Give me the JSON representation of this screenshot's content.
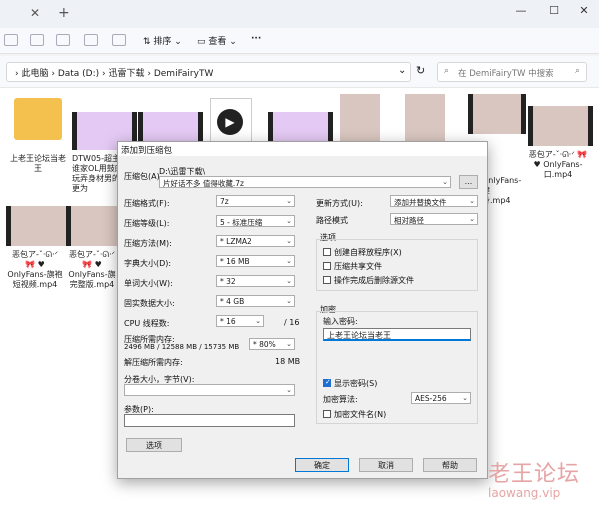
{
  "titlebar": {
    "close_tab": "✕",
    "new_tab": "+",
    "minimize": "—",
    "maximize": "☐",
    "close": "✕"
  },
  "toolbar": {
    "sort_label": "排序",
    "view_label": "查看",
    "more_label": "···"
  },
  "address": {
    "crumbs": [
      "此电脑",
      "Data (D:)",
      "迅雷下载",
      "DemiFairyTW"
    ],
    "search_placeholder": "在 DemiFairyTW 中搜索",
    "refresh_icon": "↻",
    "dropdown_icon": "⌄"
  },
  "files": [
    {
      "name": "上老王论坛当老王",
      "kind": "folder"
    },
    {
      "name": "DTW05-超主的谁家OL用鼓肉睡玩弄身材男的我更为",
      "kind": "video-purple"
    },
    {
      "name": "",
      "kind": "video-purple"
    },
    {
      "name": "",
      "kind": "media"
    },
    {
      "name": "",
      "kind": "video-purple"
    },
    {
      "name": "",
      "kind": "photo"
    },
    {
      "name": "",
      "kind": "photo"
    },
    {
      "name": "OnlyFans-健身.mp4",
      "kind": "video-photo"
    },
    {
      "name": "恶包ア-ˇ·ᘏ·ᐟ 🎀 ♥ OnlyFans-口.mp4",
      "kind": "video-photo"
    },
    {
      "name": "恶包ア-ˇ·ᘏ·ᐟ 🎀 ♥ OnlyFans-旗袍短视频.mp4",
      "kind": "video-photo"
    },
    {
      "name": "恶包ア-ˇ·ᘏ·ᐟ 🎀 ♥ OnlyFans-旗完整版.mp4",
      "kind": "video-photo"
    }
  ],
  "dialog": {
    "title": "添加到压缩包",
    "archive_label": "压缩包(A)",
    "archive_path": "D:\\迅雷下载\\",
    "archive_name": "片好话不多 值得收藏.7z",
    "browse": "...",
    "format_label": "压缩格式(F):",
    "format_value": "7z",
    "level_label": "压缩等级(L):",
    "level_value": "5 - 标准压缩",
    "method_label": "压缩方法(M):",
    "method_value": "* LZMA2",
    "dict_label": "字典大小(D):",
    "dict_value": "* 16 MB",
    "word_label": "单词大小(W):",
    "word_value": "* 32",
    "solid_label": "固实数据大小:",
    "solid_value": "* 4 GB",
    "threads_label": "CPU 线程数:",
    "threads_value": "* 16",
    "threads_total": "/ 16",
    "mem_label": "压缩所需内存:",
    "mem_value": "2496 MB / 12588 MB / 15735 MB",
    "mem_pct": "* 80%",
    "demem_label": "解压缩所需内存:",
    "demem_value": "18 MB",
    "split_label": "分卷大小，字节(V):",
    "split_value": "",
    "params_label": "参数(P):",
    "params_value": "",
    "options_button": "选项",
    "update_label": "更新方式(U):",
    "update_value": "添加并替换文件",
    "pathmode_label": "路径模式",
    "pathmode_value": "相对路径",
    "options_group": "选项",
    "opt_sfx": "创建自释放程序(X)",
    "opt_shared": "压缩共享文件",
    "opt_delete": "操作完成后删除源文件",
    "enc_group": "加密",
    "pwd_label": "输入密码:",
    "pwd_value": "上老王论坛当老王",
    "show_pwd": "显示密码(S)",
    "enc_method_label": "加密算法:",
    "enc_method_value": "AES-256",
    "enc_names": "加密文件名(N)",
    "ok": "确定",
    "cancel": "取消",
    "help": "帮助"
  },
  "watermark": {
    "line1": "老王论坛",
    "line2": "laowang.vip"
  },
  "colors": {
    "accent": "#0078d7",
    "folder": "#f4c04e"
  }
}
